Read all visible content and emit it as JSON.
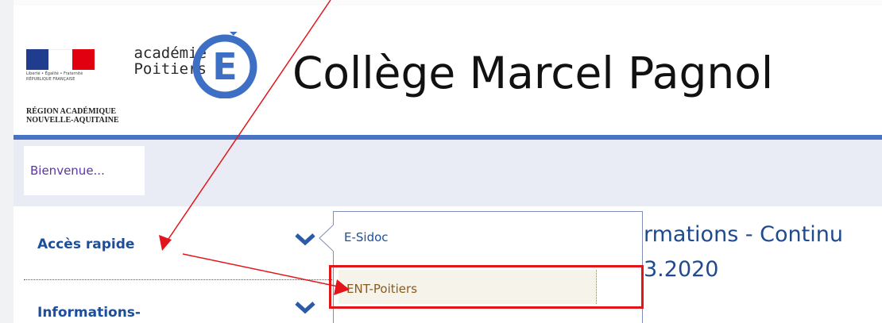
{
  "header": {
    "site_title": "Collège Marcel Pagnol",
    "academie_line1": "académie",
    "academie_line2": "Poitiers",
    "region_line1": "RÉGION ACADÉMIQUE",
    "region_line2": "NOUVELLE-AQUITAINE",
    "republic_motto_line1": "Liberté • Égalité • Fraternité",
    "republic_motto_line2": "RÉPUBLIQUE FRANÇAISE",
    "logo_letter": "E"
  },
  "nav": {
    "welcome_tab": "Bienvenue..."
  },
  "sidebar": {
    "acces_rapide": "Accès rapide",
    "informations": "Informations-"
  },
  "article": {
    "title_line1": "rmations - Continu",
    "title_line2": "3.2020"
  },
  "dropdown": {
    "items": [
      {
        "label": "E-Sidoc"
      },
      {
        "label": "ENT-Poitiers"
      }
    ]
  },
  "colors": {
    "brand_blue": "#4872c4",
    "link_blue": "#1d4e9c",
    "annotation_red": "#e2151b",
    "welcome_purple": "#5b35a6"
  },
  "icons": {
    "chevron": "chevron-down-icon",
    "logo": "e-logo-icon"
  }
}
